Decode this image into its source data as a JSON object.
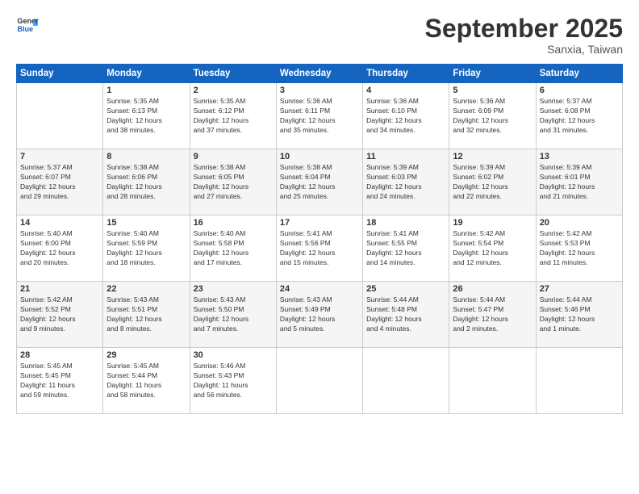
{
  "logo": {
    "line1": "General",
    "line2": "Blue"
  },
  "title": "September 2025",
  "subtitle": "Sanxia, Taiwan",
  "days_header": [
    "Sunday",
    "Monday",
    "Tuesday",
    "Wednesday",
    "Thursday",
    "Friday",
    "Saturday"
  ],
  "weeks": [
    [
      {
        "num": "",
        "info": ""
      },
      {
        "num": "1",
        "info": "Sunrise: 5:35 AM\nSunset: 6:13 PM\nDaylight: 12 hours\nand 38 minutes."
      },
      {
        "num": "2",
        "info": "Sunrise: 5:35 AM\nSunset: 6:12 PM\nDaylight: 12 hours\nand 37 minutes."
      },
      {
        "num": "3",
        "info": "Sunrise: 5:36 AM\nSunset: 6:11 PM\nDaylight: 12 hours\nand 35 minutes."
      },
      {
        "num": "4",
        "info": "Sunrise: 5:36 AM\nSunset: 6:10 PM\nDaylight: 12 hours\nand 34 minutes."
      },
      {
        "num": "5",
        "info": "Sunrise: 5:36 AM\nSunset: 6:09 PM\nDaylight: 12 hours\nand 32 minutes."
      },
      {
        "num": "6",
        "info": "Sunrise: 5:37 AM\nSunset: 6:08 PM\nDaylight: 12 hours\nand 31 minutes."
      }
    ],
    [
      {
        "num": "7",
        "info": "Sunrise: 5:37 AM\nSunset: 6:07 PM\nDaylight: 12 hours\nand 29 minutes."
      },
      {
        "num": "8",
        "info": "Sunrise: 5:38 AM\nSunset: 6:06 PM\nDaylight: 12 hours\nand 28 minutes."
      },
      {
        "num": "9",
        "info": "Sunrise: 5:38 AM\nSunset: 6:05 PM\nDaylight: 12 hours\nand 27 minutes."
      },
      {
        "num": "10",
        "info": "Sunrise: 5:38 AM\nSunset: 6:04 PM\nDaylight: 12 hours\nand 25 minutes."
      },
      {
        "num": "11",
        "info": "Sunrise: 5:39 AM\nSunset: 6:03 PM\nDaylight: 12 hours\nand 24 minutes."
      },
      {
        "num": "12",
        "info": "Sunrise: 5:39 AM\nSunset: 6:02 PM\nDaylight: 12 hours\nand 22 minutes."
      },
      {
        "num": "13",
        "info": "Sunrise: 5:39 AM\nSunset: 6:01 PM\nDaylight: 12 hours\nand 21 minutes."
      }
    ],
    [
      {
        "num": "14",
        "info": "Sunrise: 5:40 AM\nSunset: 6:00 PM\nDaylight: 12 hours\nand 20 minutes."
      },
      {
        "num": "15",
        "info": "Sunrise: 5:40 AM\nSunset: 5:59 PM\nDaylight: 12 hours\nand 18 minutes."
      },
      {
        "num": "16",
        "info": "Sunrise: 5:40 AM\nSunset: 5:58 PM\nDaylight: 12 hours\nand 17 minutes."
      },
      {
        "num": "17",
        "info": "Sunrise: 5:41 AM\nSunset: 5:56 PM\nDaylight: 12 hours\nand 15 minutes."
      },
      {
        "num": "18",
        "info": "Sunrise: 5:41 AM\nSunset: 5:55 PM\nDaylight: 12 hours\nand 14 minutes."
      },
      {
        "num": "19",
        "info": "Sunrise: 5:42 AM\nSunset: 5:54 PM\nDaylight: 12 hours\nand 12 minutes."
      },
      {
        "num": "20",
        "info": "Sunrise: 5:42 AM\nSunset: 5:53 PM\nDaylight: 12 hours\nand 11 minutes."
      }
    ],
    [
      {
        "num": "21",
        "info": "Sunrise: 5:42 AM\nSunset: 5:52 PM\nDaylight: 12 hours\nand 9 minutes."
      },
      {
        "num": "22",
        "info": "Sunrise: 5:43 AM\nSunset: 5:51 PM\nDaylight: 12 hours\nand 8 minutes."
      },
      {
        "num": "23",
        "info": "Sunrise: 5:43 AM\nSunset: 5:50 PM\nDaylight: 12 hours\nand 7 minutes."
      },
      {
        "num": "24",
        "info": "Sunrise: 5:43 AM\nSunset: 5:49 PM\nDaylight: 12 hours\nand 5 minutes."
      },
      {
        "num": "25",
        "info": "Sunrise: 5:44 AM\nSunset: 5:48 PM\nDaylight: 12 hours\nand 4 minutes."
      },
      {
        "num": "26",
        "info": "Sunrise: 5:44 AM\nSunset: 5:47 PM\nDaylight: 12 hours\nand 2 minutes."
      },
      {
        "num": "27",
        "info": "Sunrise: 5:44 AM\nSunset: 5:46 PM\nDaylight: 12 hours\nand 1 minute."
      }
    ],
    [
      {
        "num": "28",
        "info": "Sunrise: 5:45 AM\nSunset: 5:45 PM\nDaylight: 11 hours\nand 59 minutes."
      },
      {
        "num": "29",
        "info": "Sunrise: 5:45 AM\nSunset: 5:44 PM\nDaylight: 11 hours\nand 58 minutes."
      },
      {
        "num": "30",
        "info": "Sunrise: 5:46 AM\nSunset: 5:43 PM\nDaylight: 11 hours\nand 56 minutes."
      },
      {
        "num": "",
        "info": ""
      },
      {
        "num": "",
        "info": ""
      },
      {
        "num": "",
        "info": ""
      },
      {
        "num": "",
        "info": ""
      }
    ]
  ]
}
